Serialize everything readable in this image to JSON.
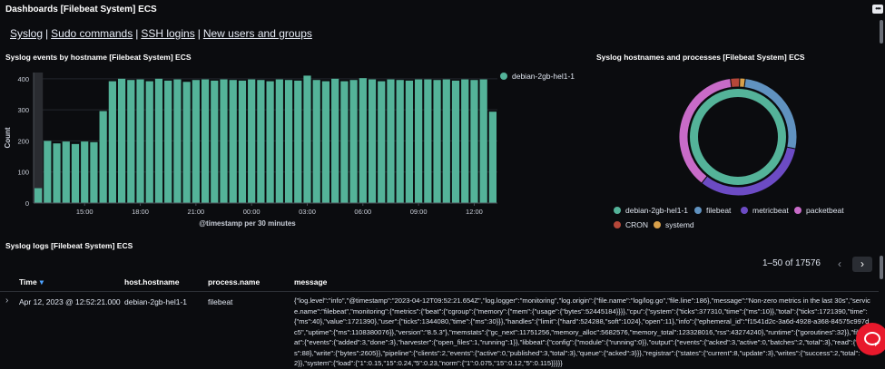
{
  "header": {
    "title": "Dashboards [Filebeat System] ECS",
    "menu_icon": "ellipsis-icon",
    "menu_label": "•••"
  },
  "nav_links": [
    {
      "label": "Syslog"
    },
    {
      "label": "Sudo commands"
    },
    {
      "label": "SSH logins"
    },
    {
      "label": "New users and groups"
    }
  ],
  "bar_panel": {
    "title": "Syslog events by hostname [Filebeat System] ECS",
    "legend": "debian-2gb-hel1-1",
    "color": "#54b399"
  },
  "chart_data": [
    {
      "type": "bar",
      "title": "Syslog events by hostname [Filebeat System] ECS",
      "xlabel": "@timestamp per 30 minutes",
      "ylabel": "Count",
      "ylim": [
        0,
        420
      ],
      "yticks": [
        0,
        100,
        200,
        300,
        400
      ],
      "xtick_labels": [
        "15:00",
        "18:00",
        "21:00",
        "00:00",
        "03:00",
        "06:00",
        "09:00",
        "12:00"
      ],
      "xtick_indices": [
        5,
        11,
        17,
        23,
        29,
        35,
        41,
        47
      ],
      "series": [
        {
          "name": "debian-2gb-hel1-1",
          "values": [
            48,
            200,
            192,
            198,
            190,
            198,
            196,
            296,
            392,
            400,
            396,
            398,
            392,
            400,
            394,
            398,
            390,
            396,
            398,
            394,
            398,
            396,
            394,
            398,
            396,
            392,
            398,
            396,
            394,
            410,
            396,
            392,
            400,
            392,
            396,
            402,
            398,
            392,
            398,
            396,
            394,
            398,
            398,
            396,
            398,
            394,
            398,
            396,
            398,
            294
          ]
        }
      ],
      "series_color": "#54b399"
    },
    {
      "type": "pie",
      "title": "Syslog hostnames and processes [Filebeat System] ECS",
      "inner_ring": [
        {
          "label": "debian-2gb-hel1-1",
          "value": 100,
          "color": "#54b399"
        }
      ],
      "outer_ring": [
        {
          "label": "filebeat",
          "value": 26,
          "color": "#6092c0"
        },
        {
          "label": "metricbeat",
          "value": 32,
          "color": "#6c4bc4"
        },
        {
          "label": "packetbeat",
          "value": 37,
          "color": "#c86bc8"
        },
        {
          "label": "CRON",
          "value": 2.5,
          "color": "#b54739"
        },
        {
          "label": "systemd",
          "value": 1.5,
          "color": "#d8a04a"
        }
      ]
    }
  ],
  "pie_panel": {
    "title": "Syslog hostnames and processes [Filebeat System] ECS",
    "legend": [
      {
        "label": "debian-2gb-hel1-1",
        "color": "#54b399"
      },
      {
        "label": "filebeat",
        "color": "#6092c0"
      },
      {
        "label": "metricbeat",
        "color": "#6c4bc4"
      },
      {
        "label": "packetbeat",
        "color": "#c86bc8"
      },
      {
        "label": "CRON",
        "color": "#b54739"
      },
      {
        "label": "systemd",
        "color": "#d8a04a"
      }
    ]
  },
  "logs_panel": {
    "title": "Syslog logs [Filebeat System] ECS",
    "pagination": "1–50 of 17576",
    "prev_icon": "‹",
    "next_icon": "›",
    "columns": [
      "Time",
      "host.hostname",
      "process.name",
      "message"
    ],
    "sort_icon": "▾",
    "rows": [
      {
        "expand": "›",
        "time": "Apr 12, 2023 @ 12:52:21.000",
        "host": "debian-2gb-hel1-1",
        "process": "filebeat",
        "message": "{\"log.level\":\"info\",\"@timestamp\":\"2023-04-12T09:52:21.654Z\",\"log.logger\":\"monitoring\",\"log.origin\":{\"file.name\":\"log/log.go\",\"file.line\":186},\"message\":\"Non-zero metrics in the last 30s\",\"service.name\":\"filebeat\",\"monitoring\":{\"metrics\":{\"beat\":{\"cgroup\":{\"memory\":{\"mem\":{\"usage\":{\"bytes\":52445184}}}},\"cpu\":{\"system\":{\"ticks\":377310,\"time\":{\"ms\":10}},\"total\":{\"ticks\":1721390,\"time\":{\"ms\":40},\"value\":1721390},\"user\":{\"ticks\":1344080,\"time\":{\"ms\":30}}},\"handles\":{\"limit\":{\"hard\":524288,\"soft\":1024},\"open\":11},\"info\":{\"ephemeral_id\":\"f1541d2c-3a6d-4928-a368-84575c997dc5\",\"uptime\":{\"ms\":1108380076}},\"version\":\"8.5.3\"},\"memstats\":{\"gc_next\":11751256,\"memory_alloc\":5682576,\"memory_total\":123328016,\"rss\":43274240},\"runtime\":{\"goroutines\":32}},\"filebeat\":{\"events\":{\"added\":3,\"done\":3},\"harvester\":{\"open_files\":1,\"running\":1}},\"libbeat\":{\"config\":{\"module\":{\"running\":0}},\"output\":{\"events\":{\"acked\":3,\"active\":0,\"batches\":2,\"total\":3},\"read\":{\"bytes\":88},\"write\":{\"bytes\":2605}},\"pipeline\":{\"clients\":2,\"events\":{\"active\":0,\"published\":3,\"total\":3},\"queue\":{\"acked\":3}}},\"registrar\":{\"states\":{\"current\":8,\"update\":3},\"writes\":{\"success\":2,\"total\":2}},\"system\":{\"load\":{\"1\":0.15,\"15\":0.24,\"5\":0.23,\"norm\":{\"1\":0.075,\"15\":0.12,\"5\":0.115}}}}}"
      }
    ]
  }
}
